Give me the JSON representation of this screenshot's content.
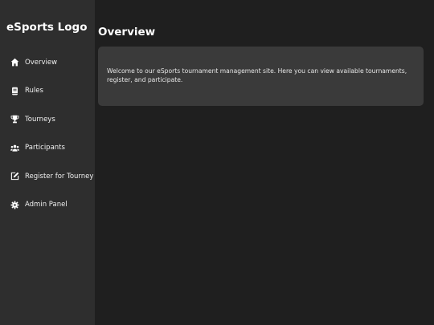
{
  "sidebar": {
    "logo": "eSports Logo",
    "items": [
      {
        "label": "Overview",
        "icon": "home-icon"
      },
      {
        "label": "Rules",
        "icon": "book-icon"
      },
      {
        "label": "Tourneys",
        "icon": "trophy-icon"
      },
      {
        "label": "Participants",
        "icon": "users-icon"
      },
      {
        "label": "Register for Tourney",
        "icon": "edit-icon"
      },
      {
        "label": "Admin Panel",
        "icon": "gear-icon"
      }
    ]
  },
  "main": {
    "title": "Overview",
    "welcome_text": "Welcome to our eSports tournament management site. Here you can view available tournaments, register, and participate."
  },
  "colors": {
    "background": "#1f1f1f",
    "sidebar": "#2e2e2e",
    "card": "#3a3a3a",
    "text": "#ffffff"
  }
}
